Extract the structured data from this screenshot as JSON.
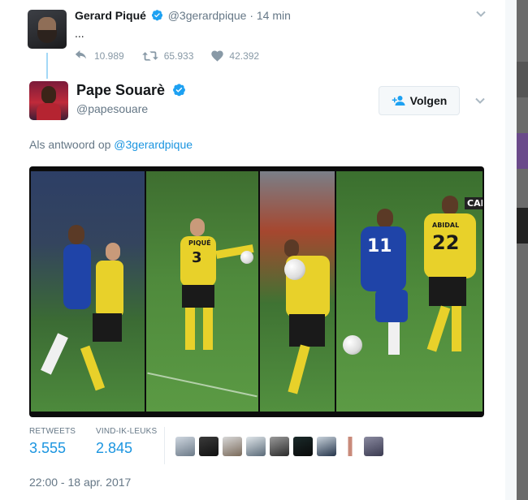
{
  "parent_tweet": {
    "name": "Gerard Piqué",
    "handle": "@3gerardpique",
    "separator": "·",
    "time": "14 min",
    "text": "...",
    "replies": "10.989",
    "retweets": "65.933",
    "likes": "42.392"
  },
  "tweet": {
    "name": "Pape Souarè",
    "handle": "@papesouare",
    "follow_label": "Volgen",
    "reply_prefix": "Als antwoord op",
    "reply_to": "@3gerardpique",
    "media": {
      "jersey_numbers": [
        "3",
        "11",
        "22"
      ],
      "jersey_names": [
        "PIQUÉ",
        "ABIDAL"
      ],
      "corner_logo": "CAN"
    },
    "stats": {
      "retweets_label": "RETWEETS",
      "retweets_value": "3.555",
      "likes_label": "VIND-IK-LEUKS",
      "likes_value": "2.845"
    },
    "timestamp": "22:00 - 18 apr. 2017"
  },
  "colors": {
    "accent": "#1b95e0",
    "verified": "#1da1f2",
    "muted": "#657786",
    "thread": "#a4d9f7"
  },
  "icons": {
    "verified": "verified-badge-icon",
    "reply": "reply-icon",
    "retweet": "retweet-icon",
    "like": "heart-icon",
    "follow": "add-person-icon",
    "caret": "chevron-down-icon"
  }
}
